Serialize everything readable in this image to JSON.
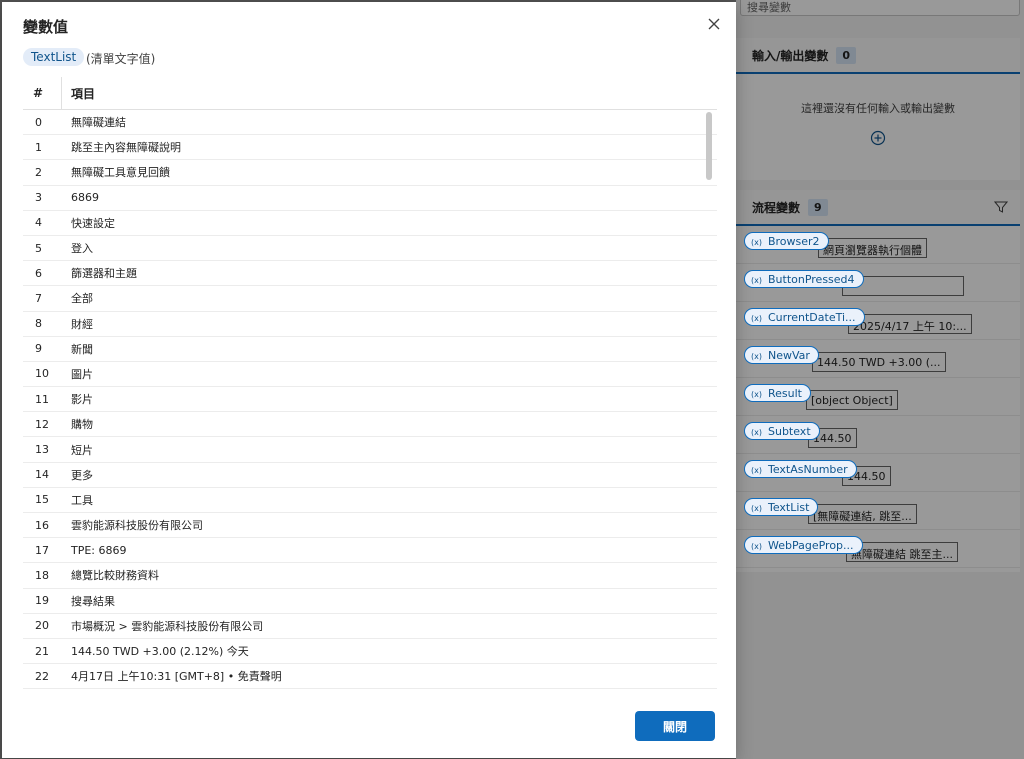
{
  "background": {
    "search_placeholder": "搜尋變數",
    "io_section": {
      "title": "輸入/輸出變數",
      "count": "0",
      "empty_text": "這裡還沒有任何輸入或輸出變數"
    },
    "flow_section": {
      "title": "流程變數",
      "count": "9",
      "variables": [
        {
          "name": "Browser2",
          "value": "網頁瀏覽器執行個體"
        },
        {
          "name": "ButtonPressed4",
          "value": ""
        },
        {
          "name": "CurrentDateTi...",
          "value": "2025/4/17 上午 10:..."
        },
        {
          "name": "NewVar",
          "value": "144.50 TWD +3.00 (..."
        },
        {
          "name": "Result",
          "value": "[object Object]"
        },
        {
          "name": "Subtext",
          "value": "144.50"
        },
        {
          "name": "TextAsNumber",
          "value": "144.50"
        },
        {
          "name": "TextList",
          "value": "[無障礙連結, 跳至..."
        },
        {
          "name": "WebPageProp...",
          "value": "無障礙連結 跳至主..."
        }
      ]
    }
  },
  "dialog": {
    "title": "變數值",
    "type_badge": "TextList",
    "type_desc": "(清單文字值)",
    "table": {
      "headers": {
        "index": "#",
        "item": "項目"
      },
      "rows": [
        {
          "index": "0",
          "item": "無障礙連結"
        },
        {
          "index": "1",
          "item": "跳至主內容無障礙說明"
        },
        {
          "index": "2",
          "item": "無障礙工具意見回饋"
        },
        {
          "index": "3",
          "item": "6869"
        },
        {
          "index": "4",
          "item": "快速設定"
        },
        {
          "index": "5",
          "item": "登入"
        },
        {
          "index": "6",
          "item": "篩選器和主題"
        },
        {
          "index": "7",
          "item": "全部"
        },
        {
          "index": "8",
          "item": "財經"
        },
        {
          "index": "9",
          "item": "新聞"
        },
        {
          "index": "10",
          "item": "圖片"
        },
        {
          "index": "11",
          "item": "影片"
        },
        {
          "index": "12",
          "item": "購物"
        },
        {
          "index": "13",
          "item": "短片"
        },
        {
          "index": "14",
          "item": "更多"
        },
        {
          "index": "15",
          "item": "工具"
        },
        {
          "index": "16",
          "item": "雲豹能源科技股份有限公司"
        },
        {
          "index": "17",
          "item": "TPE: 6869"
        },
        {
          "index": "18",
          "item": "總覽比較財務資料"
        },
        {
          "index": "19",
          "item": "搜尋結果"
        },
        {
          "index": "20",
          "item": "市場概況 > 雲豹能源科技股份有限公司"
        },
        {
          "index": "21",
          "item": "144.50 TWD +3.00 (2.12%) 今天"
        },
        {
          "index": "22",
          "item": "4月17日 上午10:31 [GMT+8] • 免責聲明"
        }
      ]
    },
    "close_button_label": "關閉"
  }
}
